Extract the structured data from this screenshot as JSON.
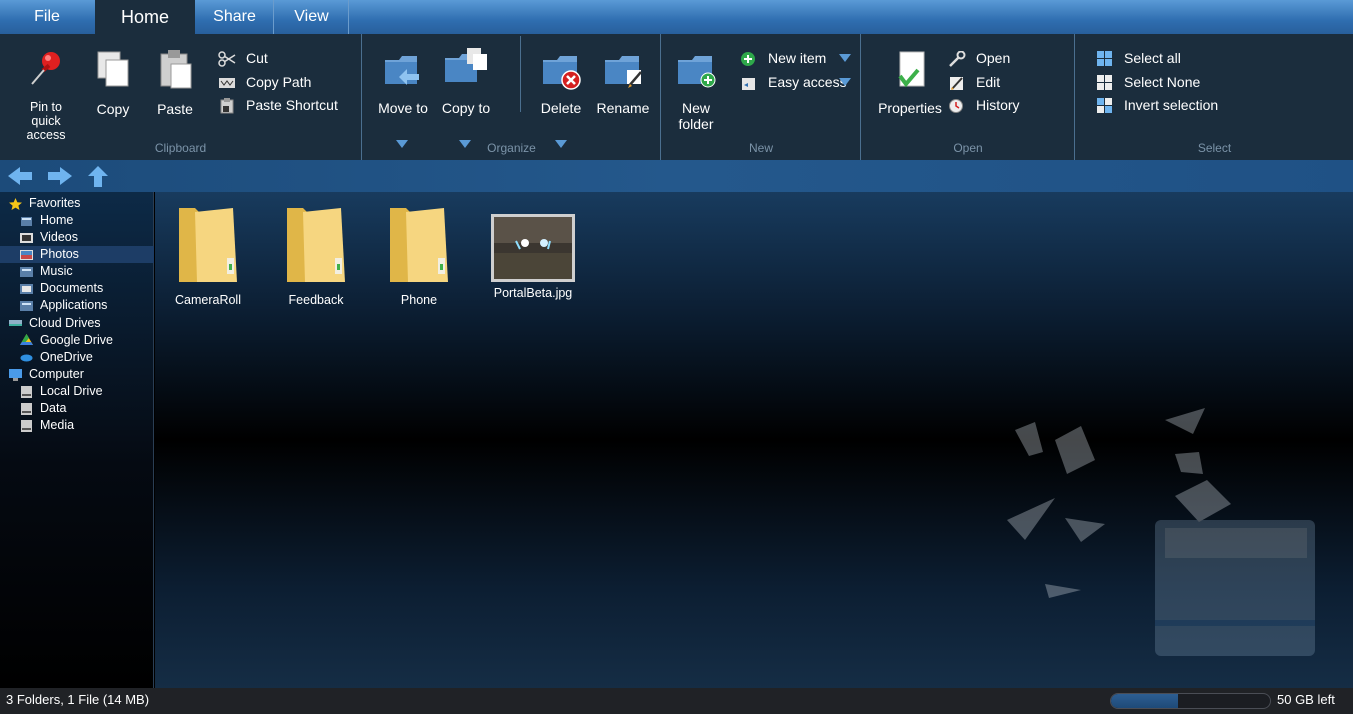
{
  "tabs": [
    {
      "label": "File"
    },
    {
      "label": "Home"
    },
    {
      "label": "Share"
    },
    {
      "label": "View"
    }
  ],
  "ribbon": {
    "clipboard": {
      "label": "Clipboard",
      "pin_label": "Pin to quick access",
      "copy_label": "Copy",
      "paste_label": "Paste",
      "cut_label": "Cut",
      "copy_path_label": "Copy Path",
      "paste_shortcut_label": "Paste Shortcut"
    },
    "organize": {
      "label": "Organize",
      "move_to_label": "Move to",
      "copy_to_label": "Copy to",
      "delete_label": "Delete",
      "rename_label": "Rename"
    },
    "new": {
      "label": "New",
      "new_folder_label": "New folder",
      "new_item_label": "New item",
      "easy_access_label": "Easy access"
    },
    "open": {
      "label": "Open",
      "properties_label": "Properties",
      "open_label": "Open",
      "edit_label": "Edit",
      "history_label": "History"
    },
    "select": {
      "label": "Select",
      "select_all_label": "Select all",
      "select_none_label": "Select None",
      "invert_label": "Invert selection"
    }
  },
  "sidebar": {
    "items": [
      {
        "label": "Favorites",
        "icon": "star-icon",
        "level": 0,
        "selected": false
      },
      {
        "label": "Home",
        "icon": "home-icon",
        "level": 1,
        "selected": false
      },
      {
        "label": "Videos",
        "icon": "videos-icon",
        "level": 1,
        "selected": false
      },
      {
        "label": "Photos",
        "icon": "photos-icon",
        "level": 1,
        "selected": true
      },
      {
        "label": "Music",
        "icon": "music-icon",
        "level": 1,
        "selected": false
      },
      {
        "label": "Documents",
        "icon": "documents-icon",
        "level": 1,
        "selected": false
      },
      {
        "label": "Applications",
        "icon": "applications-icon",
        "level": 1,
        "selected": false
      },
      {
        "label": "Cloud Drives",
        "icon": "cloud-drives-icon",
        "level": 0,
        "selected": false
      },
      {
        "label": "Google Drive",
        "icon": "google-drive-icon",
        "level": 1,
        "selected": false
      },
      {
        "label": "OneDrive",
        "icon": "onedrive-icon",
        "level": 1,
        "selected": false
      },
      {
        "label": "Computer",
        "icon": "computer-icon",
        "level": 0,
        "selected": false
      },
      {
        "label": "Local Drive",
        "icon": "drive-icon",
        "level": 1,
        "selected": false
      },
      {
        "label": "Data",
        "icon": "drive-icon",
        "level": 1,
        "selected": false
      },
      {
        "label": "Media",
        "icon": "drive-icon",
        "level": 1,
        "selected": false
      }
    ]
  },
  "files": [
    {
      "name": "CameraRoll",
      "type": "folder"
    },
    {
      "name": "Feedback",
      "type": "folder"
    },
    {
      "name": "Phone",
      "type": "folder"
    },
    {
      "name": "PortalBeta.jpg",
      "type": "image"
    }
  ],
  "status": {
    "summary": "3 Folders, 1 File (14 MB)",
    "free_space": "50 GB left",
    "used_fraction": 0.42
  },
  "colors": {
    "accent": "#5a9ad6",
    "ribbon_bg": "#1b2d3d",
    "selected_nav": "#1d3d66"
  }
}
